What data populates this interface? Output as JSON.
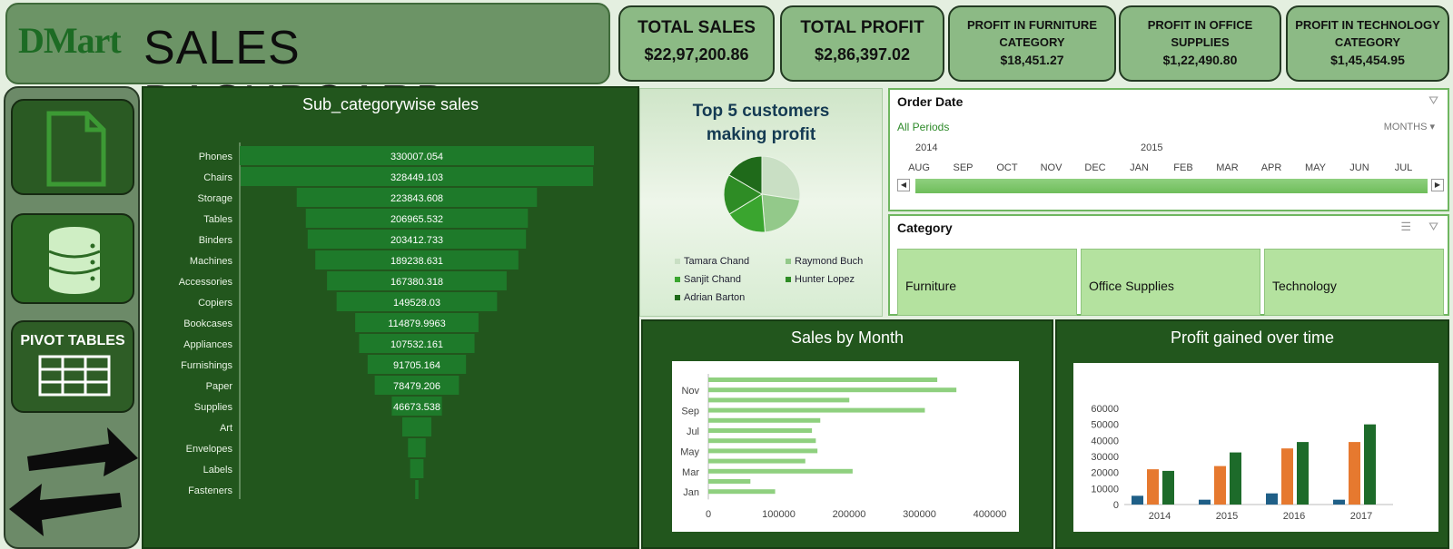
{
  "header": {
    "logo": "DMart",
    "title": "SALES DASHBOARD"
  },
  "kpis": [
    {
      "label": "TOTAL  SALES",
      "value": "$22,97,200.86"
    },
    {
      "label": "TOTAL PROFIT",
      "value": "$2,86,397.02"
    },
    {
      "label": "PROFIT IN FURNITURE CATEGORY",
      "value": "$18,451.27"
    },
    {
      "label": "PROFIT IN OFFICE SUPPLIES",
      "value": "$1,22,490.80"
    },
    {
      "label": "PROFIT IN TECHNOLOGY CATEGORY",
      "value": "$1,45,454.95"
    }
  ],
  "sidebar": {
    "pivot_label": "PIVOT TABLES"
  },
  "icons": [
    "document-icon",
    "database-icon",
    "table-icon",
    "swap-arrows-icon",
    "filter-clear-icon",
    "multi-select-icon"
  ],
  "colors": {
    "dark_green": "#22561d",
    "bar_green": "#1e7a2a",
    "light_green": "#8fd07f",
    "tile_green": "#b4e29f",
    "blue": "#1f5f87",
    "orange": "#e6792f",
    "green2": "#1d6b2a"
  },
  "funnel": {
    "title": "Sub_categorywise sales",
    "chart_data": {
      "type": "bar",
      "categories": [
        "Phones",
        "Chairs",
        "Storage",
        "Tables",
        "Binders",
        "Machines",
        "Accessories",
        "Copiers",
        "Bookcases",
        "Appliances",
        "Furnishings",
        "Paper",
        "Supplies",
        "Art",
        "Envelopes",
        "Labels",
        "Fasteners"
      ],
      "values": [
        330007.054,
        328449.103,
        223843.608,
        206965.532,
        203412.733,
        189238.631,
        167380.318,
        149528.03,
        114879.9963,
        107532.161,
        91705.164,
        78479.206,
        46673.538,
        27118.792,
        16476.402,
        12486.312,
        3024.28
      ],
      "labels": [
        "330007.054",
        "328449.103",
        "223843.608",
        "206965.532",
        "203412.733",
        "189238.631",
        "167380.318",
        "149528.03",
        "114879.9963",
        "107532.161",
        "91705.164",
        "78479.206",
        "46673.538",
        "",
        "",
        "",
        ""
      ]
    }
  },
  "pie": {
    "title_line1": "Top 5 customers",
    "title_line2": "making profit",
    "chart_data": {
      "type": "pie",
      "categories": [
        "Tamara Chand",
        "Raymond Buch",
        "Sanjit Chand",
        "Hunter Lopez",
        "Adrian Barton"
      ],
      "values": [
        8981,
        6976,
        5757,
        5622,
        5444
      ],
      "colors": [
        "#c9dfc4",
        "#93c98a",
        "#3aa52f",
        "#2e8c25",
        "#1f6a1a"
      ]
    }
  },
  "order_date": {
    "title": "Order Date",
    "periods": "All Periods",
    "unit": "MONTHS",
    "years": [
      "2014",
      "2015"
    ],
    "months": [
      "AUG",
      "SEP",
      "OCT",
      "NOV",
      "DEC",
      "JAN",
      "FEB",
      "MAR",
      "APR",
      "MAY",
      "JUN",
      "JUL"
    ]
  },
  "category": {
    "title": "Category",
    "items": [
      "Furniture",
      "Office Supplies",
      "Technology"
    ]
  },
  "sales_month": {
    "title": "Sales by Month",
    "chart_data": {
      "type": "bar",
      "orientation": "horizontal",
      "categories": [
        "Jan",
        "Feb",
        "Mar",
        "Apr",
        "May",
        "Jun",
        "Jul",
        "Aug",
        "Sep",
        "Oct",
        "Nov",
        "Dec"
      ],
      "y_tick_labels": [
        "Jan",
        "Mar",
        "May",
        "Jul",
        "Sep",
        "Nov"
      ],
      "values": [
        94925,
        59751,
        205005,
        137762,
        155029,
        152719,
        147238,
        159044,
        307650,
        200323,
        352461,
        325294
      ],
      "xlim": [
        0,
        400000
      ],
      "x_ticks": [
        "0",
        "100000",
        "200000",
        "300000",
        "400000"
      ]
    }
  },
  "profit_time": {
    "title": "Profit gained over time",
    "chart_data": {
      "type": "bar",
      "categories": [
        "2014",
        "2015",
        "2016",
        "2017"
      ],
      "series": [
        {
          "values": [
            5458,
            3015,
            6960,
            3018
          ]
        },
        {
          "values": [
            22000,
            24000,
            35000,
            39000
          ]
        },
        {
          "values": [
            21000,
            32500,
            39000,
            50000
          ]
        }
      ],
      "ylim": [
        0,
        60000
      ],
      "y_ticks": [
        "0",
        "10000",
        "20000",
        "30000",
        "40000",
        "50000",
        "60000"
      ]
    }
  }
}
